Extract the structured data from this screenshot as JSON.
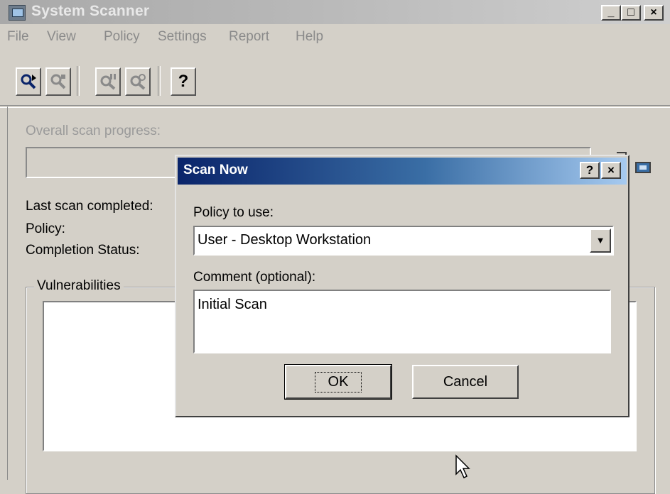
{
  "window": {
    "title": "System Scanner",
    "controls": [
      "_",
      "□",
      "×"
    ]
  },
  "menu": [
    "File",
    "View",
    "Policy",
    "Settings",
    "Report",
    "Help"
  ],
  "toolbar": {
    "buttons": [
      "scan-now-icon",
      "scan-stop-icon",
      "pause-icon",
      "view-icon",
      "help-icon"
    ],
    "help_label": "?"
  },
  "main": {
    "progress_label": "Overall scan progress:",
    "last_scan_label": "Last scan completed:",
    "policy_label": "Policy:",
    "status_label": "Completion Status:",
    "vulnerabilities_label": "Vulnerabilities"
  },
  "dialog": {
    "title": "Scan Now",
    "help_btn": "?",
    "close_btn": "×",
    "policy_label": "Policy to use:",
    "policy_value": "User - Desktop Workstation",
    "comment_label": "Comment (optional):",
    "comment_value": "Initial Scan",
    "ok_label": "OK",
    "cancel_label": "Cancel"
  }
}
